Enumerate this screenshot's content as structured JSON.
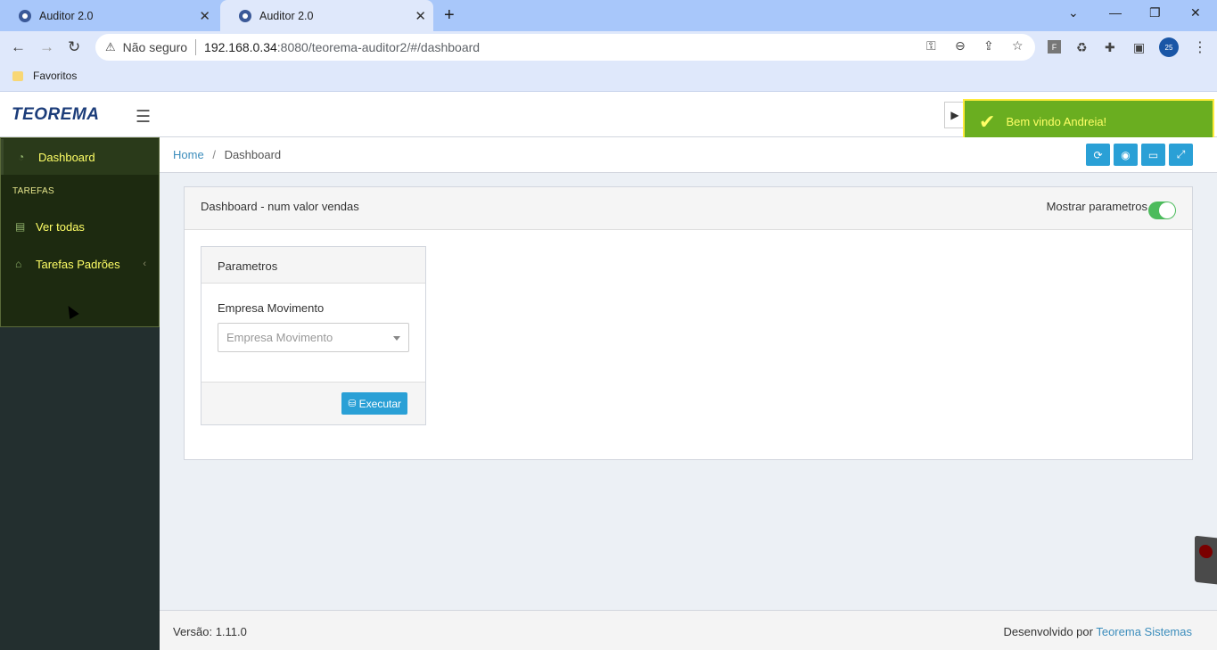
{
  "browser": {
    "tabs": [
      {
        "title": "Auditor 2.0"
      },
      {
        "title": "Auditor 2.0"
      }
    ],
    "address": {
      "security": "Não seguro",
      "host": "192.168.0.34",
      "path": ":8080/teorema-auditor2/#/dashboard"
    },
    "bookmark": "Favoritos",
    "profile_initials": "25",
    "ext_label": "F"
  },
  "app": {
    "logo": "TEOREMA",
    "toast": "Bem vindo Andreia!"
  },
  "sidebar": {
    "dashboard": "Dashboard",
    "section": "TAREFAS",
    "items": [
      {
        "label": "Ver todas"
      },
      {
        "label": "Tarefas Padrões"
      }
    ]
  },
  "breadcrumb": {
    "home": "Home",
    "current": "Dashboard"
  },
  "panel": {
    "title": "Dashboard - num valor vendas",
    "toggle_label": "Mostrar parametros",
    "params_title": "Parametros",
    "field_label": "Empresa Movimento",
    "field_placeholder": "Empresa Movimento",
    "execute": "Executar"
  },
  "footer": {
    "version": "Versão: 1.11.0",
    "developed_by": "Desenvolvido por",
    "company": "Teorema Sistemas"
  },
  "colors": {
    "accent": "#2aa0d6",
    "toast_bg": "#62aa14",
    "sidebar_text": "#ffff66"
  }
}
